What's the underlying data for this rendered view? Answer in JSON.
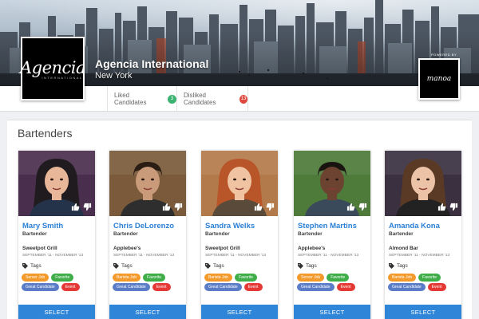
{
  "company": {
    "logo_text": "Agencia",
    "logo_subtext": "INTERNATIONAL",
    "name": "Agencia International",
    "city": "New York",
    "powered_by": "POWERED BY",
    "partner_logo_text": "manoa"
  },
  "stats": {
    "liked_label": "Liked Candidates",
    "liked_count": "3",
    "disliked_label": "Disliked Candidates",
    "disliked_count": "13"
  },
  "section": {
    "title": "Bartenders"
  },
  "colors": {
    "accent": "#2f86d8",
    "name": "#2b7fd4",
    "liked_badge": "#3cb371",
    "disliked_badge": "#e0483e",
    "orange_tag": "#f39a2b",
    "green_tag": "#3fae49",
    "blue_tag": "#5b7dc7",
    "red_tag": "#e53935"
  },
  "candidates": [
    {
      "name": "Mary Smith",
      "role": "Bartender",
      "venue": "Sweetpot Grill",
      "dates": "SEPTEMBER '11 - NOVEMBER '13",
      "tags_label": "Tags",
      "tags": [
        {
          "label": "Server Job",
          "color": "#f39a2b"
        },
        {
          "label": "Favorite",
          "color": "#3fae49"
        },
        {
          "label": "Great Candidate",
          "color": "#5b7dc7"
        },
        {
          "label": "Event",
          "color": "#e53935"
        }
      ],
      "select_label": "SELECT",
      "photo": "woman-dark-hair-headset"
    },
    {
      "name": "Chris DeLorenzo",
      "role": "Bartender",
      "venue": "Applebee's",
      "dates": "SEPTEMBER '11 - NOVEMBER '13",
      "tags_label": "Tags",
      "tags": [
        {
          "label": "Barista Job",
          "color": "#f39a2b"
        },
        {
          "label": "Favorite",
          "color": "#3fae49"
        },
        {
          "label": "Great Candidate",
          "color": "#5b7dc7"
        },
        {
          "label": "Event",
          "color": "#e53935"
        }
      ],
      "select_label": "SELECT",
      "photo": "man-in-bar"
    },
    {
      "name": "Sandra Welks",
      "role": "Bartender",
      "venue": "Sweetpot Grill",
      "dates": "SEPTEMBER '11 - NOVEMBER '13",
      "tags_label": "Tags",
      "tags": [
        {
          "label": "Barista Job",
          "color": "#f39a2b"
        },
        {
          "label": "Favorite",
          "color": "#3fae49"
        },
        {
          "label": "Great Candidate",
          "color": "#5b7dc7"
        },
        {
          "label": "Event",
          "color": "#e53935"
        }
      ],
      "select_label": "SELECT",
      "photo": "woman-red-hair"
    },
    {
      "name": "Stephen Martins",
      "role": "Bartender",
      "venue": "Applebee's",
      "dates": "SEPTEMBER '11 - NOVEMBER '13",
      "tags_label": "Tags",
      "tags": [
        {
          "label": "Server Job",
          "color": "#f39a2b"
        },
        {
          "label": "Favorite",
          "color": "#3fae49"
        },
        {
          "label": "Great Candidate",
          "color": "#5b7dc7"
        },
        {
          "label": "Event",
          "color": "#e53935"
        }
      ],
      "select_label": "SELECT",
      "photo": "man-outdoors"
    },
    {
      "name": "Amanda Kona",
      "role": "Bartender",
      "venue": "Almond Bar",
      "dates": "SEPTEMBER '11 - NOVEMBER '13",
      "tags_label": "Tags",
      "tags": [
        {
          "label": "Barista Job",
          "color": "#f39a2b"
        },
        {
          "label": "Favorite",
          "color": "#3fae49"
        },
        {
          "label": "Great Candidate",
          "color": "#5b7dc7"
        },
        {
          "label": "Event",
          "color": "#e53935"
        }
      ],
      "select_label": "SELECT",
      "photo": "woman-brown-hair"
    }
  ]
}
